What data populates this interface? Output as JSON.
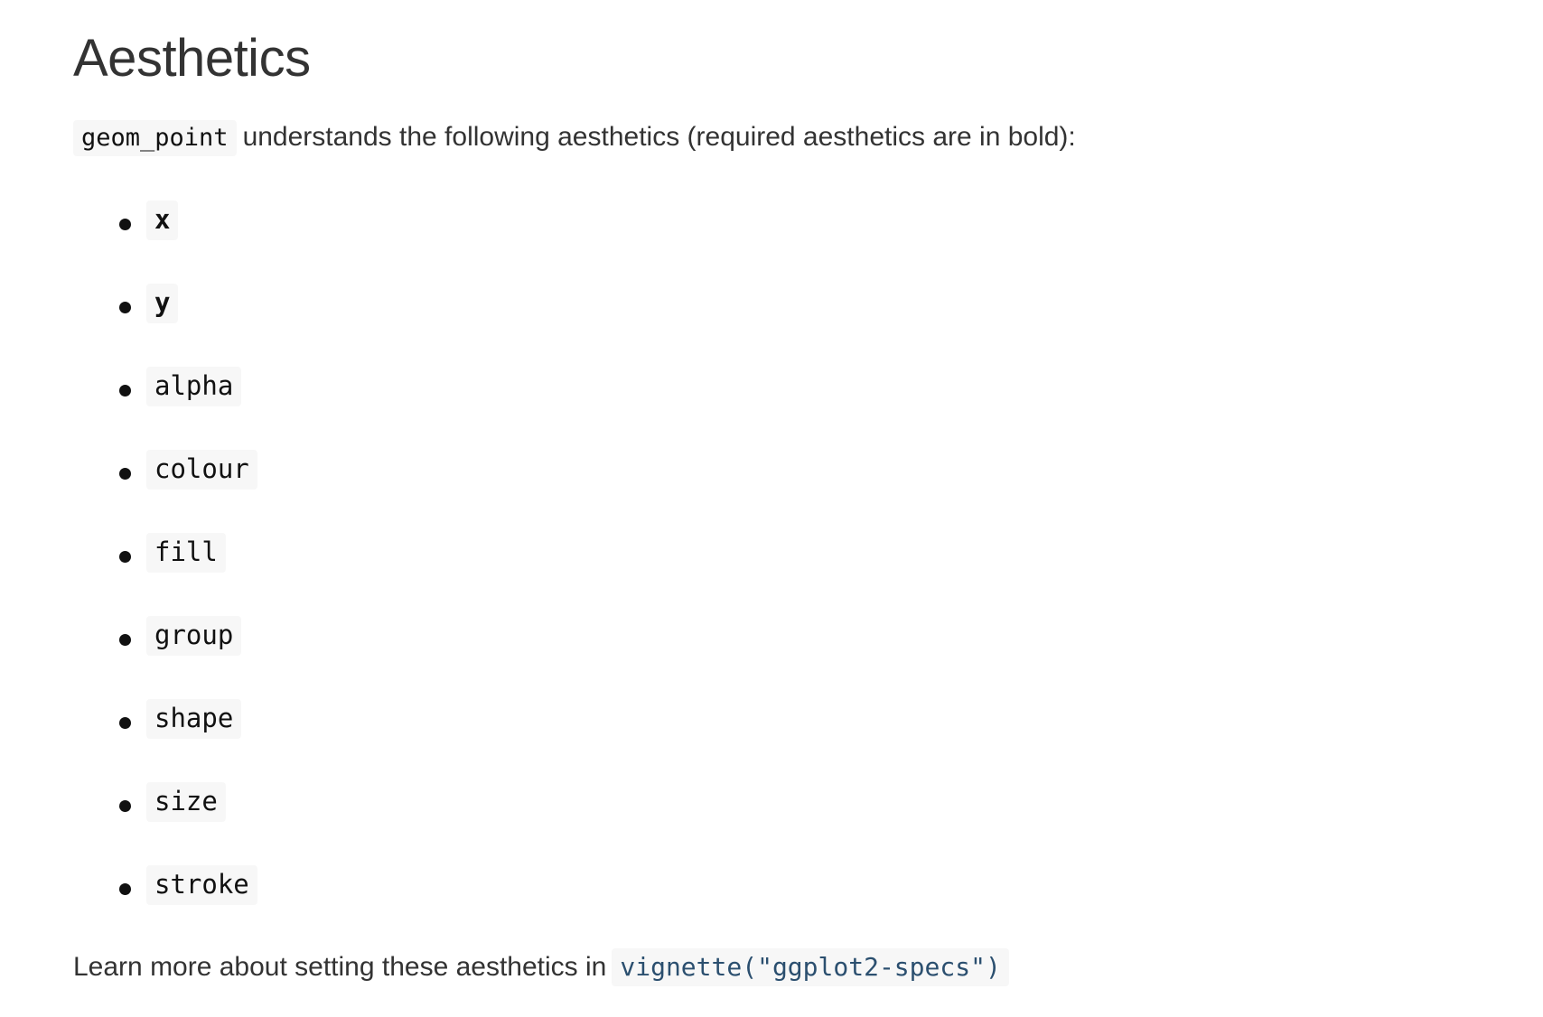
{
  "title": "Aesthetics",
  "intro": {
    "code": "geom_point",
    "text": "understands the following aesthetics (required aesthetics are in bold):"
  },
  "aesthetics": [
    {
      "name": "x",
      "required": true
    },
    {
      "name": "y",
      "required": true
    },
    {
      "name": "alpha",
      "required": false
    },
    {
      "name": "colour",
      "required": false
    },
    {
      "name": "fill",
      "required": false
    },
    {
      "name": "group",
      "required": false
    },
    {
      "name": "shape",
      "required": false
    },
    {
      "name": "size",
      "required": false
    },
    {
      "name": "stroke",
      "required": false
    }
  ],
  "footer": {
    "text": "Learn more about setting these aesthetics in",
    "code_link": "vignette(\"ggplot2-specs\")"
  }
}
